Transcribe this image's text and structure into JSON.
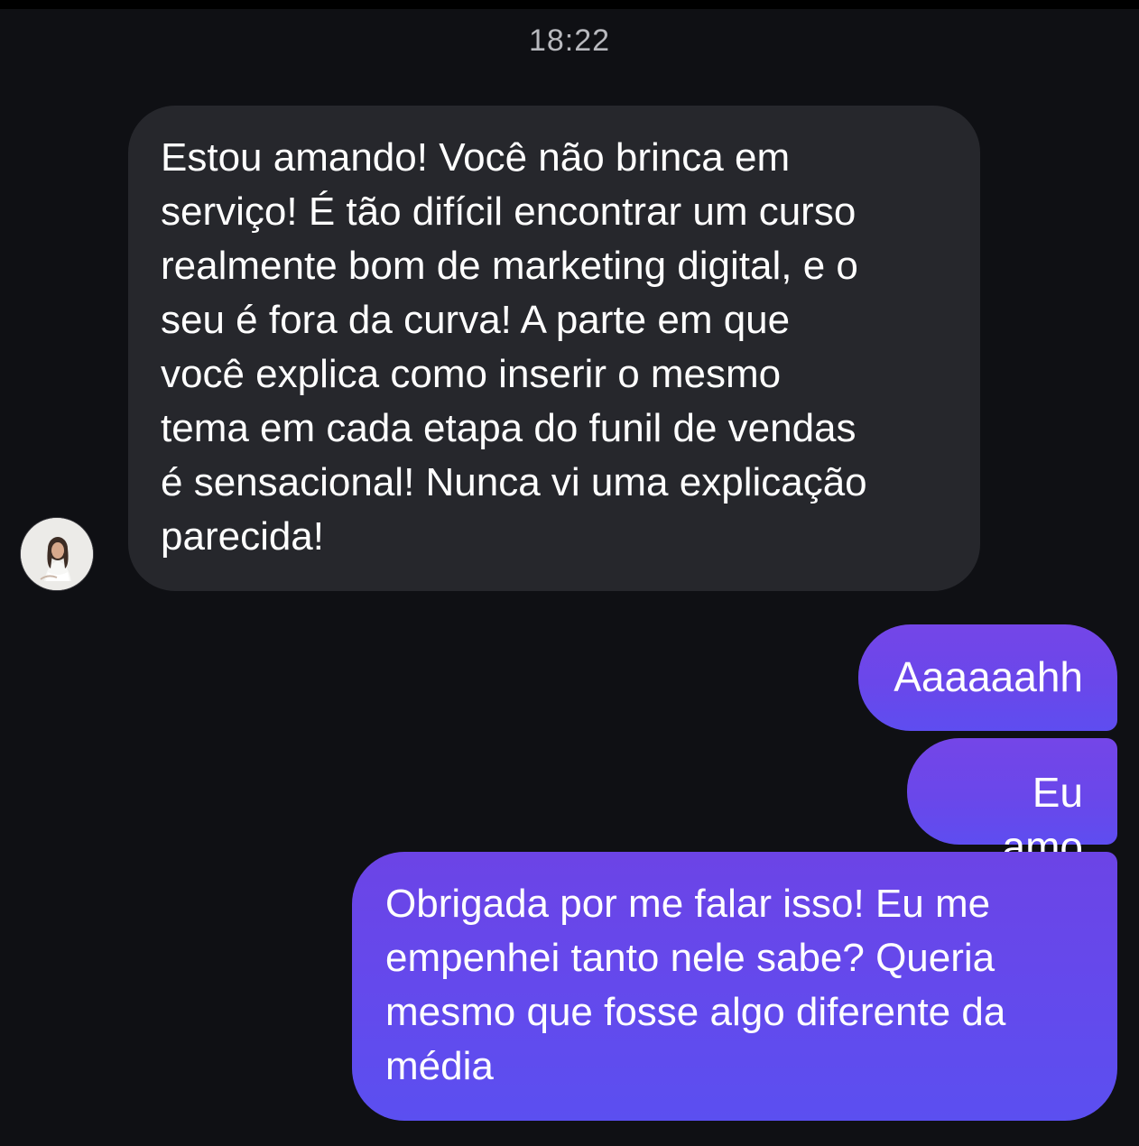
{
  "header": {
    "timestamp": "18:22"
  },
  "messages": [
    {
      "direction": "incoming",
      "text": "Estou amando! Você não brinca em\nserviço! É tão difícil encontrar um curso\nrealmente bom de marketing digital, e o\nseu é fora da curva! A parte em que\nvocê explica como inserir o mesmo\ntema em cada etapa do funil de vendas\né sensacional! Nunca vi uma explicação\nparecida!"
    },
    {
      "direction": "outgoing",
      "text": "Aaaaaahh"
    },
    {
      "direction": "outgoing",
      "text": "Eu amo"
    },
    {
      "direction": "outgoing",
      "text": "Obrigada por me falar isso! Eu me\nempenhei tanto nele sabe? Queria\nmesmo que fosse algo diferente da\nmédia"
    }
  ],
  "colors": {
    "background": "#0f1014",
    "incoming_bubble": "#26272c",
    "outgoing_bubble_top": "#7446e8",
    "outgoing_bubble_bottom": "#5e4df0",
    "timestamp_text": "#b8b9be"
  },
  "icons": {
    "avatar": "profile-photo"
  }
}
